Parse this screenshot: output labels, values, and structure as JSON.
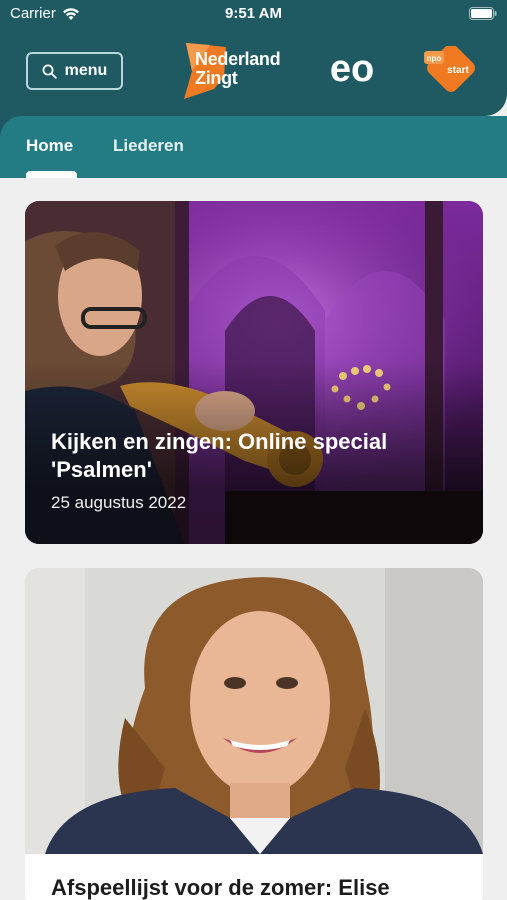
{
  "status_bar": {
    "carrier": "Carrier",
    "time": "9:51 AM"
  },
  "header": {
    "menu_label": "menu",
    "logo_nz_line1": "Nederland",
    "logo_nz_line2": "Zingt",
    "logo_eo": "eo",
    "logo_npo_top": "npo",
    "logo_npo_bottom": "start"
  },
  "tabs": [
    {
      "label": "Home",
      "active": true
    },
    {
      "label": "Liederen",
      "active": false
    }
  ],
  "articles": [
    {
      "title": "Kijken en zingen: Online special 'Psalmen'",
      "date": "25 augustus 2022",
      "image": "trumpet-player-in-church-photo"
    },
    {
      "title": "Afspeellijst voor de zomer: Elise",
      "image": "woman-portrait-photo"
    }
  ],
  "colors": {
    "header": "#1f5a62",
    "tabs": "#237b83",
    "logo_orange": "#f07a22",
    "background": "#efefef"
  }
}
